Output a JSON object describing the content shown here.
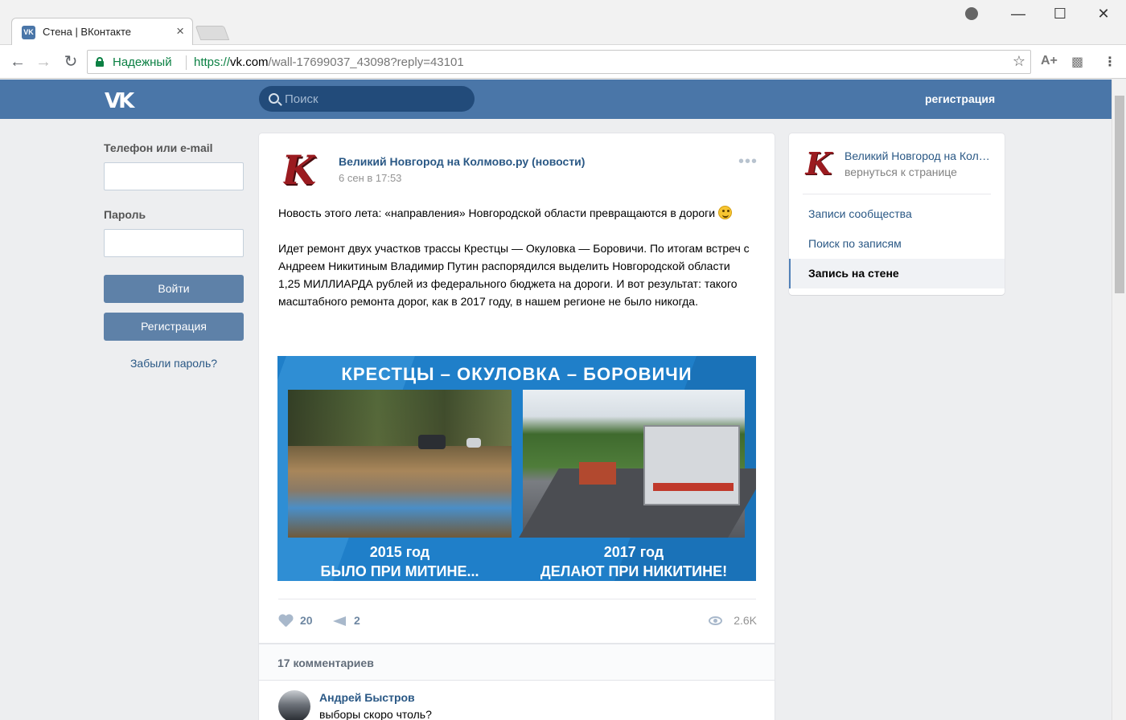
{
  "browser": {
    "tab_title": "Стена | ВКонтакте",
    "tab_favicon": "VK",
    "tab_close": "×",
    "secure_label": "Надежный",
    "url_scheme": "https://",
    "url_host": "vk.com",
    "url_path": "/wall-17699037_43098?reply=43101",
    "window_minimize": "—",
    "window_maximize": "☐",
    "window_close": "✕",
    "nav_back": "←",
    "nav_forward": "→",
    "nav_reload": "↻",
    "star": "☆",
    "ext_font": "A+",
    "ext_image": "▩",
    "menu": "⋮"
  },
  "header": {
    "logo": "VK",
    "search_placeholder": "Поиск",
    "register_link": "регистрация"
  },
  "login": {
    "phone_label": "Телефон или e-mail",
    "phone_value": "",
    "password_label": "Пароль",
    "password_value": "",
    "login_button": "Войти",
    "register_button": "Регистрация",
    "forgot_link": "Забыли пароль?"
  },
  "post": {
    "avatar_letter": "K",
    "author": "Великий Новгород на Колмово.ру (новости)",
    "date": "6 сен в 17:53",
    "more": "•••",
    "text_1": "Новость этого лета: «направления» Новгородской области превращаются в дороги",
    "text_2": "Идет ремонт двух участков трассы Крестцы — Окуловка — Боровичи. По итогам встреч с Андреем Никитиным Владимир Путин распорядился выделить Новгородской области 1,25 МИЛЛИАРДА рублей из федерального бюджета на дороги. И вот результат: такого масштабного ремонта дорог, как в 2017 году, в нашем регионе не было никогда.",
    "image": {
      "title": "КРЕСТЦЫ – ОКУЛОВКА – БОРОВИЧИ",
      "left_year": "2015 год",
      "left_caption": "БЫЛО ПРИ МИТИНЕ...",
      "right_year": "2017 год",
      "right_caption": "ДЕЛАЮТ ПРИ НИКИТИНЕ!"
    },
    "likes": "20",
    "shares": "2",
    "views": "2.6K"
  },
  "comments": {
    "count_label": "17 комментариев",
    "items": [
      {
        "author": "Андрей Быстров",
        "text": "выборы скоро чтоль?"
      }
    ]
  },
  "side": {
    "avatar_letter": "K",
    "name": "Великий Новгород на Колмово.ру (новости)",
    "back": "вернуться к странице",
    "items": [
      {
        "label": "Записи сообщества"
      },
      {
        "label": "Поиск по записям"
      },
      {
        "label": "Запись на стене"
      }
    ]
  }
}
